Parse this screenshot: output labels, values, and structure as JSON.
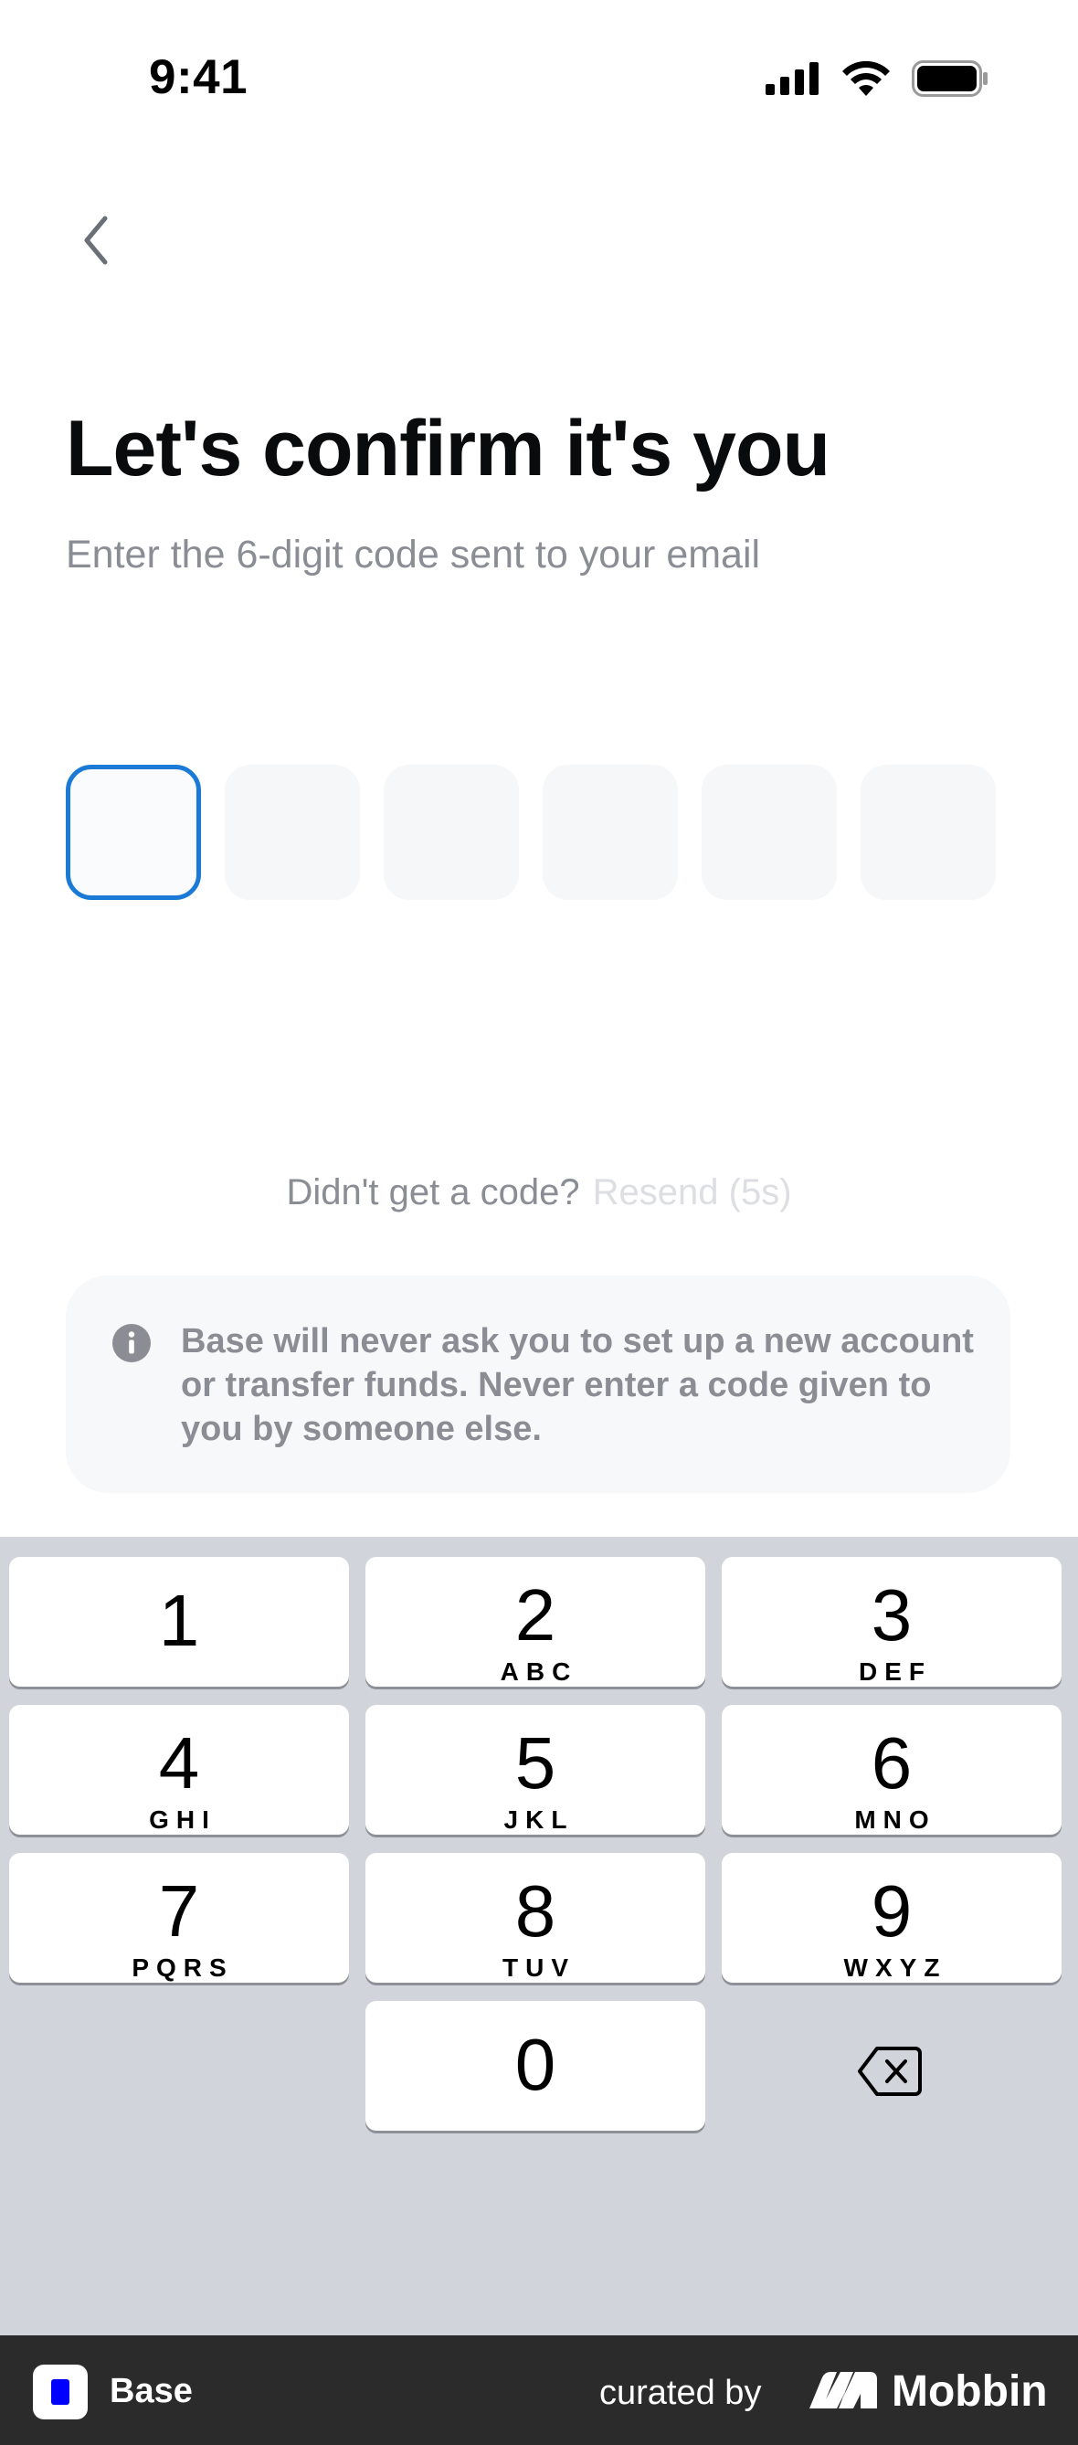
{
  "status_bar": {
    "time": "9:41",
    "icons": [
      "cellular-signal-icon",
      "wifi-icon",
      "battery-icon"
    ]
  },
  "header": {
    "back_icon": "chevron-left-icon"
  },
  "main": {
    "title": "Let's confirm it's you",
    "subtitle": "Enter the 6-digit code sent to your email",
    "code_length": 6,
    "code_values": [
      "",
      "",
      "",
      "",
      "",
      ""
    ],
    "active_index": 0,
    "resend_question": "Didn't get a code?",
    "resend_link": "Resend (5s)",
    "info": {
      "icon": "info-icon",
      "text": "Base will never ask you to set up a new account or transfer funds. Never enter a code given to you by someone else."
    }
  },
  "keypad": {
    "keys": [
      {
        "num": "1",
        "letters": ""
      },
      {
        "num": "2",
        "letters": "ABC"
      },
      {
        "num": "3",
        "letters": "DEF"
      },
      {
        "num": "4",
        "letters": "GHI"
      },
      {
        "num": "5",
        "letters": "JKL"
      },
      {
        "num": "6",
        "letters": "MNO"
      },
      {
        "num": "7",
        "letters": "PQRS"
      },
      {
        "num": "8",
        "letters": "TUV"
      },
      {
        "num": "9",
        "letters": "WXYZ"
      },
      {
        "num": "0",
        "letters": ""
      }
    ],
    "delete_icon": "backspace-icon"
  },
  "footer": {
    "app_name": "Base",
    "curated_by": "curated by",
    "brand": "Mobbin"
  },
  "colors": {
    "accent": "#1a7ad6",
    "title": "#0a0b0d",
    "muted": "#8a8d93",
    "keypad_bg": "#d1d4da"
  }
}
